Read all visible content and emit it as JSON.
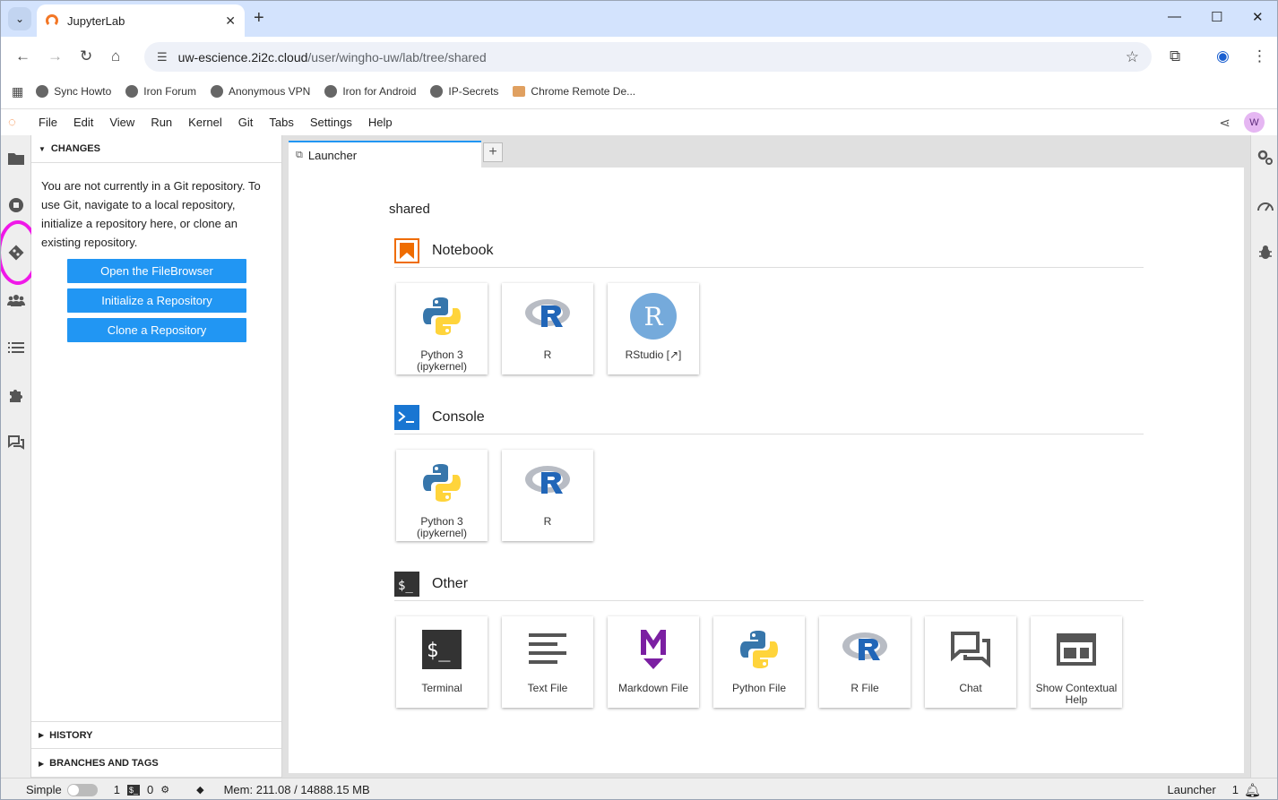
{
  "browser": {
    "tab_title": "JupyterLab",
    "url_site": "uw-escience.2i2c.cloud",
    "url_path": "/user/wingho-uw/lab/tree/shared",
    "bookmarks": [
      "Sync Howto",
      "Iron Forum",
      "Anonymous VPN",
      "Iron for Android",
      "IP-Secrets",
      "Chrome Remote De..."
    ]
  },
  "menu": {
    "items": [
      "File",
      "Edit",
      "View",
      "Run",
      "Kernel",
      "Git",
      "Tabs",
      "Settings",
      "Help"
    ],
    "avatar": "W"
  },
  "git": {
    "changes_title": "CHANGES",
    "message": "You are not currently in a Git repository. To use Git, navigate to a local repository, initialize a repository here, or clone an existing repository.",
    "buttons": [
      "Open the FileBrowser",
      "Initialize a Repository",
      "Clone a Repository"
    ],
    "history_title": "HISTORY",
    "branches_title": "BRANCHES AND TAGS"
  },
  "launcher": {
    "tab_label": "Launcher",
    "folder": "shared",
    "notebook": {
      "title": "Notebook",
      "cards": [
        {
          "label": "Python 3 (ipykernel)",
          "icon": "python-icon"
        },
        {
          "label": "R",
          "icon": "r-icon"
        },
        {
          "label": "RStudio [↗]",
          "icon": "rstudio-icon"
        }
      ]
    },
    "console": {
      "title": "Console",
      "cards": [
        {
          "label": "Python 3 (ipykernel)",
          "icon": "python-icon"
        },
        {
          "label": "R",
          "icon": "r-icon"
        }
      ]
    },
    "other": {
      "title": "Other",
      "cards": [
        {
          "label": "Terminal",
          "icon": "terminal-icon"
        },
        {
          "label": "Text File",
          "icon": "text-file-icon"
        },
        {
          "label": "Markdown File",
          "icon": "markdown-icon"
        },
        {
          "label": "Python File",
          "icon": "python-icon"
        },
        {
          "label": "R File",
          "icon": "r-icon"
        },
        {
          "label": "Chat",
          "icon": "chat-icon"
        },
        {
          "label": "Show Contextual Help",
          "icon": "contextual-help-icon"
        }
      ]
    }
  },
  "status": {
    "mode": "Simple",
    "terminals": "1",
    "kernels": "0",
    "memory": "Mem: 211.08 / 14888.15 MB",
    "active": "Launcher",
    "notifications": "1"
  },
  "colors": {
    "accent": "#2196f3",
    "jupyter_orange": "#f37726",
    "highlight": "#f018e8"
  }
}
